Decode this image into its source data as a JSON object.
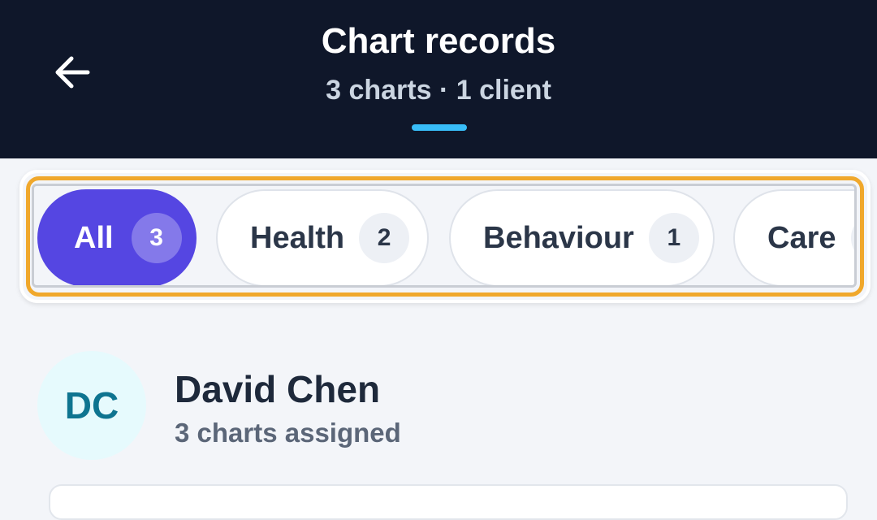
{
  "header": {
    "title": "Chart records",
    "subtitle": "3 charts · 1 client",
    "back_icon": "arrow-left-icon"
  },
  "filters": [
    {
      "label": "All",
      "count": "3",
      "active": true
    },
    {
      "label": "Health",
      "count": "2",
      "active": false
    },
    {
      "label": "Behaviour",
      "count": "1",
      "active": false
    },
    {
      "label": "Care",
      "count": "",
      "active": false
    }
  ],
  "client": {
    "initials": "DC",
    "name": "David Chen",
    "meta": "3 charts assigned"
  },
  "colors": {
    "header_bg": "#0f172a",
    "accent": "#5546e2",
    "indicator": "#38bdf8",
    "highlight": "#f0a82c",
    "avatar_bg": "#e6fafd",
    "avatar_text": "#0e7490"
  }
}
